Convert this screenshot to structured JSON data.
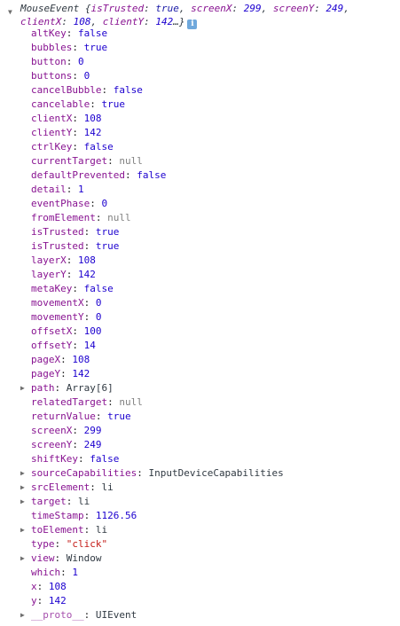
{
  "header": {
    "class_name": "MouseEvent",
    "open_brace": " {",
    "p1_key": "isTrusted",
    "p1_val": "true",
    "p2_key": "screenX",
    "p2_val": "299",
    "p3_key": "screenY",
    "p3_val": "249",
    "p4_key": "clientX",
    "p4_val": "108",
    "p5_key": "clientY",
    "p5_val": "142",
    "ellipsis": "…}",
    "info_glyph": "i"
  },
  "properties": [
    {
      "key": "altKey",
      "value": "false",
      "type": "bool",
      "expandable": false
    },
    {
      "key": "bubbles",
      "value": "true",
      "type": "bool",
      "expandable": false
    },
    {
      "key": "button",
      "value": "0",
      "type": "number",
      "expandable": false
    },
    {
      "key": "buttons",
      "value": "0",
      "type": "number",
      "expandable": false
    },
    {
      "key": "cancelBubble",
      "value": "false",
      "type": "bool",
      "expandable": false
    },
    {
      "key": "cancelable",
      "value": "true",
      "type": "bool",
      "expandable": false
    },
    {
      "key": "clientX",
      "value": "108",
      "type": "number",
      "expandable": false
    },
    {
      "key": "clientY",
      "value": "142",
      "type": "number",
      "expandable": false
    },
    {
      "key": "ctrlKey",
      "value": "false",
      "type": "bool",
      "expandable": false
    },
    {
      "key": "currentTarget",
      "value": "null",
      "type": "null",
      "expandable": false
    },
    {
      "key": "defaultPrevented",
      "value": "false",
      "type": "bool",
      "expandable": false
    },
    {
      "key": "detail",
      "value": "1",
      "type": "number",
      "expandable": false
    },
    {
      "key": "eventPhase",
      "value": "0",
      "type": "number",
      "expandable": false
    },
    {
      "key": "fromElement",
      "value": "null",
      "type": "null",
      "expandable": false
    },
    {
      "key": "isTrusted",
      "value": "true",
      "type": "bool",
      "expandable": false
    },
    {
      "key": "isTrusted",
      "value": "true",
      "type": "bool",
      "expandable": false
    },
    {
      "key": "layerX",
      "value": "108",
      "type": "number",
      "expandable": false
    },
    {
      "key": "layerY",
      "value": "142",
      "type": "number",
      "expandable": false
    },
    {
      "key": "metaKey",
      "value": "false",
      "type": "bool",
      "expandable": false
    },
    {
      "key": "movementX",
      "value": "0",
      "type": "number",
      "expandable": false
    },
    {
      "key": "movementY",
      "value": "0",
      "type": "number",
      "expandable": false
    },
    {
      "key": "offsetX",
      "value": "100",
      "type": "number",
      "expandable": false
    },
    {
      "key": "offsetY",
      "value": "14",
      "type": "number",
      "expandable": false
    },
    {
      "key": "pageX",
      "value": "108",
      "type": "number",
      "expandable": false
    },
    {
      "key": "pageY",
      "value": "142",
      "type": "number",
      "expandable": false
    },
    {
      "key": "path",
      "value": "Array[6]",
      "type": "object",
      "expandable": true
    },
    {
      "key": "relatedTarget",
      "value": "null",
      "type": "null",
      "expandable": false
    },
    {
      "key": "returnValue",
      "value": "true",
      "type": "bool",
      "expandable": false
    },
    {
      "key": "screenX",
      "value": "299",
      "type": "number",
      "expandable": false
    },
    {
      "key": "screenY",
      "value": "249",
      "type": "number",
      "expandable": false
    },
    {
      "key": "shiftKey",
      "value": "false",
      "type": "bool",
      "expandable": false
    },
    {
      "key": "sourceCapabilities",
      "value": "InputDeviceCapabilities",
      "type": "object",
      "expandable": true
    },
    {
      "key": "srcElement",
      "value": "li",
      "type": "object",
      "expandable": true
    },
    {
      "key": "target",
      "value": "li",
      "type": "object",
      "expandable": true
    },
    {
      "key": "timeStamp",
      "value": "1126.56",
      "type": "number",
      "expandable": false
    },
    {
      "key": "toElement",
      "value": "li",
      "type": "object",
      "expandable": true
    },
    {
      "key": "type",
      "value": "\"click\"",
      "type": "string",
      "expandable": false
    },
    {
      "key": "view",
      "value": "Window",
      "type": "object",
      "expandable": true
    },
    {
      "key": "which",
      "value": "1",
      "type": "number",
      "expandable": false
    },
    {
      "key": "x",
      "value": "108",
      "type": "number",
      "expandable": false
    },
    {
      "key": "y",
      "value": "142",
      "type": "number",
      "expandable": false
    },
    {
      "key": "__proto__",
      "value": "UIEvent",
      "type": "object",
      "expandable": true
    }
  ],
  "glyphs": {
    "expanded": "▼",
    "collapsed": "▶",
    "separator": ": "
  }
}
